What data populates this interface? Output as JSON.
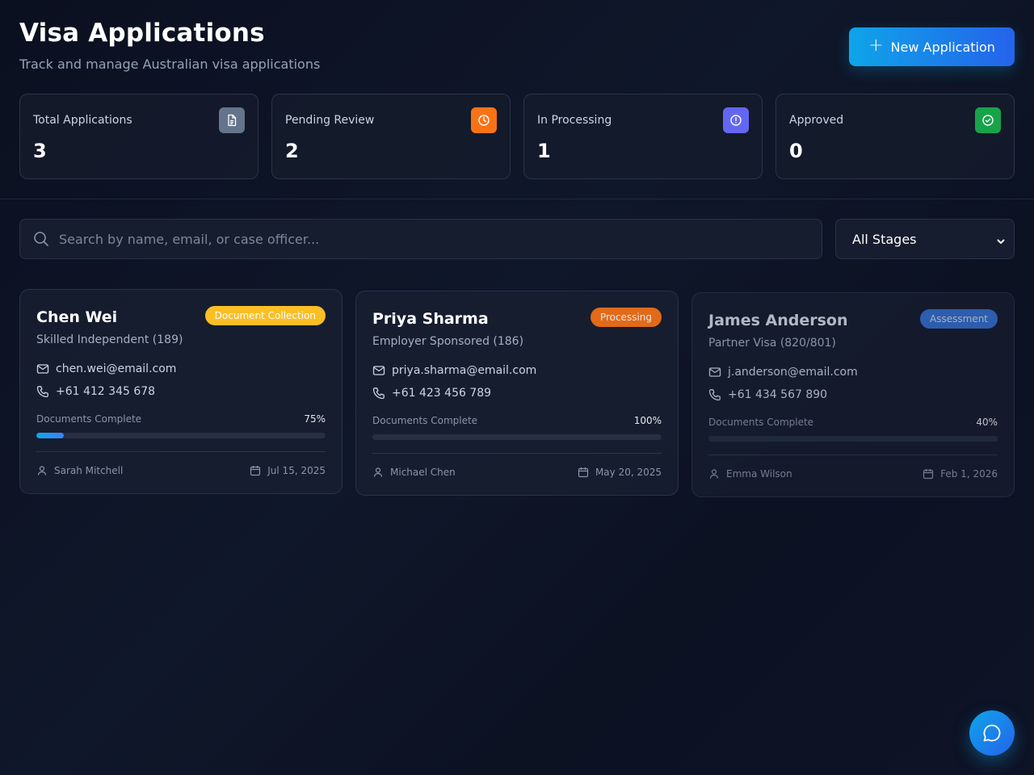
{
  "header": {
    "title": "Visa Applications",
    "subtitle": "Track and manage Australian visa applications",
    "new_button_label": "New Application"
  },
  "stats": [
    {
      "label": "Total Applications",
      "value": "3",
      "icon": "document-icon",
      "color": "#64748b"
    },
    {
      "label": "Pending Review",
      "value": "2",
      "icon": "clock-icon",
      "color": "#f97316"
    },
    {
      "label": "In Processing",
      "value": "1",
      "icon": "alert-circle-icon",
      "color": "#6366f1"
    },
    {
      "label": "Approved",
      "value": "0",
      "icon": "check-circle-icon",
      "color": "#16a34a"
    }
  ],
  "search": {
    "placeholder": "Search by name, email, or case officer...",
    "value": ""
  },
  "stage_filter": {
    "selected": "All Stages"
  },
  "applications": [
    {
      "name": "Chen Wei",
      "visa_type": "Skilled Independent (189)",
      "stage": "Document Collection",
      "stage_color": "#fbbf24",
      "email": "chen.wei@email.com",
      "phone": "+61 412 345 678",
      "docs_label": "Documents Complete",
      "docs_percent_text": "75%",
      "progress_fill_percent": 9.5,
      "case_officer": "Sarah Mitchell",
      "date": "Jul 15, 2025"
    },
    {
      "name": "Priya Sharma",
      "visa_type": "Employer Sponsored (186)",
      "stage": "Processing",
      "stage_color": "#f97316",
      "email": "priya.sharma@email.com",
      "phone": "+61 423 456 789",
      "docs_label": "Documents Complete",
      "docs_percent_text": "100%",
      "progress_fill_percent": 0,
      "case_officer": "Michael Chen",
      "date": "May 20, 2025"
    },
    {
      "name": "James Anderson",
      "visa_type": "Partner Visa (820/801)",
      "stage": "Assessment",
      "stage_color": "#3b82f6",
      "email": "j.anderson@email.com",
      "phone": "+61 434 567 890",
      "docs_label": "Documents Complete",
      "docs_percent_text": "40%",
      "progress_fill_percent": 0,
      "case_officer": "Emma Wilson",
      "date": "Feb 1, 2026"
    }
  ],
  "chat": {
    "icon": "chat-bubble-icon"
  }
}
